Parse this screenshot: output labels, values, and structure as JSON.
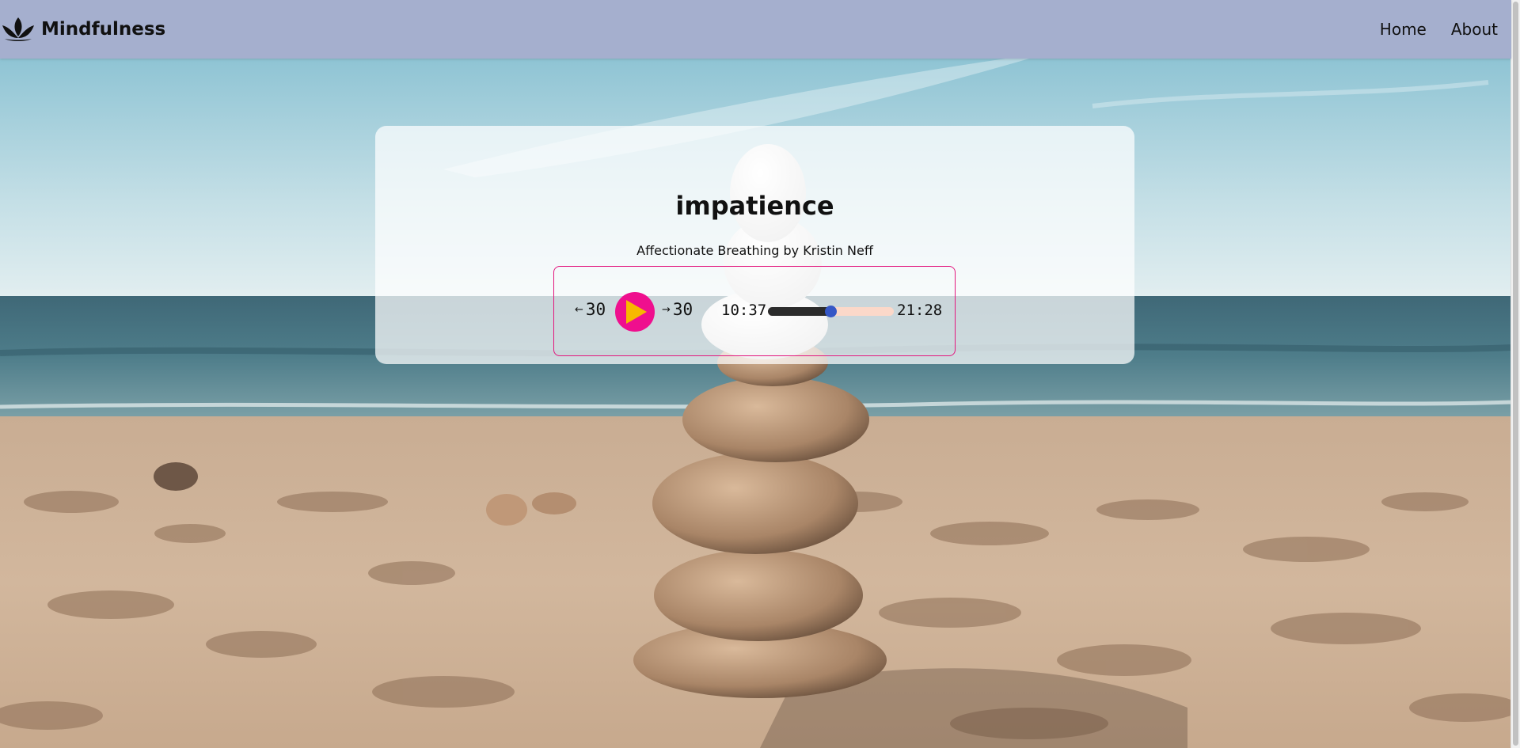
{
  "nav": {
    "brand": "Mindfulness",
    "links": [
      "Home",
      "About"
    ]
  },
  "player": {
    "title": "impatience",
    "subtitle": "Affectionate Breathing by Kristin Neff",
    "skip_back_label": "30",
    "skip_forward_label": "30",
    "current_time": "10:37",
    "total_time": "21:28",
    "progress_fraction": 0.495
  },
  "colors": {
    "nav_background": "#a5afce",
    "play_button": "#ef0f8e",
    "play_icon": "#f7b800",
    "player_border": "#e3177e",
    "progress_fill": "#2b2b2b",
    "progress_track": "#fbd8c9",
    "progress_thumb": "#3557c6"
  },
  "icons": {
    "brand": "lotus-icon",
    "play": "play-icon",
    "skip_back": "arrow-left-icon",
    "skip_forward": "arrow-right-icon"
  }
}
